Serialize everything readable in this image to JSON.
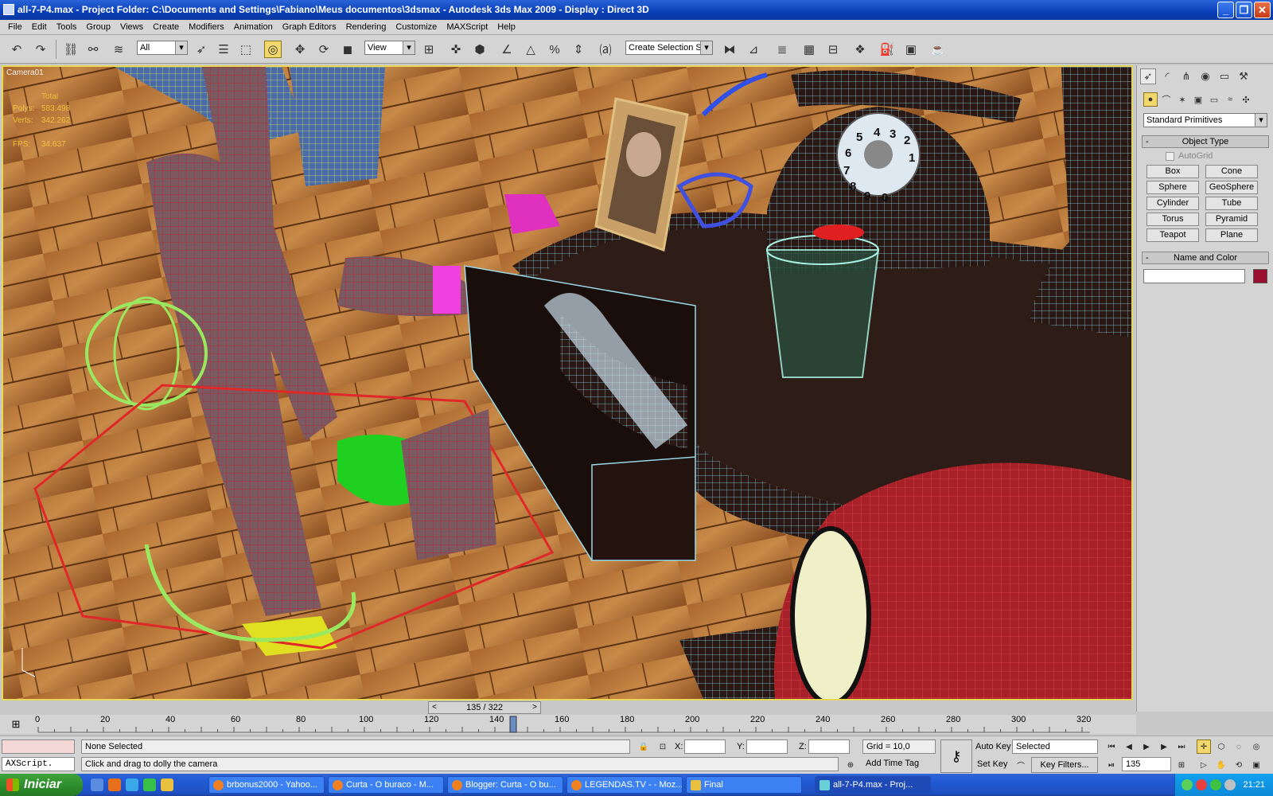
{
  "window": {
    "title": "all-7-P4.max     - Project Folder: C:\\Documents and Settings\\Fabiano\\Meus documentos\\3dsmax     - Autodesk 3ds Max  2009      - Display : Direct 3D",
    "min_icon": "minimize-icon",
    "max_icon": "restore-icon",
    "close_icon": "close-icon"
  },
  "menu": [
    "File",
    "Edit",
    "Tools",
    "Group",
    "Views",
    "Create",
    "Modifiers",
    "Animation",
    "Graph Editors",
    "Rendering",
    "Customize",
    "MAXScript",
    "Help"
  ],
  "toolbar": {
    "selection_filter": "All",
    "reference_coord": "View",
    "named_selection": "Create Selection Set"
  },
  "viewport": {
    "label": "Camera01",
    "stats": {
      "total_label": "Total",
      "polys_label": "Polys:",
      "polys_value": "583.498",
      "verts_label": "Verts:",
      "verts_value": "342.262",
      "fps_label": "FPS:",
      "fps_value": "34.637"
    },
    "frame_numbers": [
      "5",
      "4",
      "3",
      "2",
      "1",
      "6",
      "7",
      "8",
      "9",
      "0"
    ]
  },
  "command_panel": {
    "category": "Standard Primitives",
    "object_type_title": "Object Type",
    "autogrid": "AutoGrid",
    "buttons": [
      "Box",
      "Cone",
      "Sphere",
      "GeoSphere",
      "Cylinder",
      "Tube",
      "Torus",
      "Pyramid",
      "Teapot",
      "Plane"
    ],
    "name_color_title": "Name and Color",
    "object_color": "#9a1030"
  },
  "timeline": {
    "slider_label": "135 / 322",
    "ticks": [
      "0",
      "20",
      "40",
      "60",
      "80",
      "100",
      "120",
      "140",
      "160",
      "180",
      "200",
      "220",
      "240",
      "260",
      "280",
      "300",
      "320"
    ]
  },
  "status": {
    "maxscript": "AXScript.",
    "selection": "None Selected",
    "prompt": "Click and drag to dolly the camera",
    "x_label": "X:",
    "y_label": "Y:",
    "z_label": "Z:",
    "grid": "Grid = 10,0",
    "add_time_tag": "Add Time Tag",
    "auto_key": "Auto Key",
    "set_key": "Set Key",
    "key_mode": "Selected",
    "key_filters": "Key Filters...",
    "current_frame": "135"
  },
  "taskbar": {
    "start": "Iniciar",
    "tasks": [
      "brbonus2000 - Yahoo...",
      "Curta - O buraco - M...",
      "Blogger: Curta - O bu...",
      "LEGENDAS.TV - - Moz...",
      "Final",
      "all-7-P4.max     - Proj..."
    ],
    "clock": "21:21"
  }
}
